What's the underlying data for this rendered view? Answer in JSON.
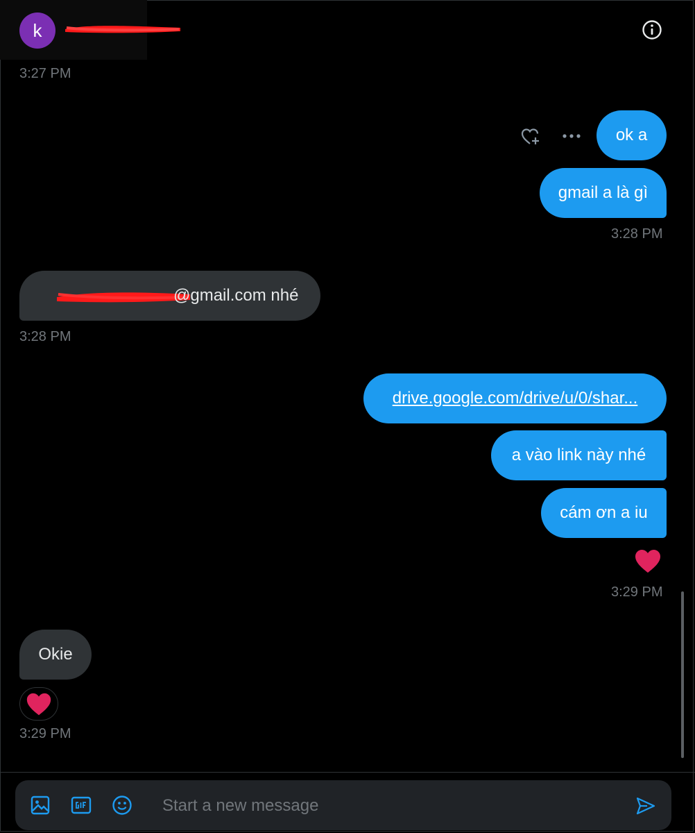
{
  "conversation": {
    "avatar_letter": "k",
    "info_icon": "info-circle-icon"
  },
  "messages": {
    "t1": "3:27 PM",
    "sent_ok": "ok a",
    "sent_gmail": "gmail a là gì",
    "t2": "3:28 PM",
    "recv_email_suffix": "@gmail.com nhé",
    "t3": "3:28 PM",
    "sent_link": "drive.google.com/drive/u/0/shar...",
    "sent_vao_link": "a vào link này nhé",
    "sent_cam_on": "cám ơn a iu",
    "t4": "3:29 PM",
    "recv_okie": "Okie",
    "t5": "3:29 PM"
  },
  "composer": {
    "placeholder": "Start a new message"
  },
  "colors": {
    "accent": "#1d9bf0",
    "received_bubble": "#2f3336",
    "heart": "#f91880",
    "avatar": "#7b2fb3",
    "redaction": "#ff0000"
  }
}
